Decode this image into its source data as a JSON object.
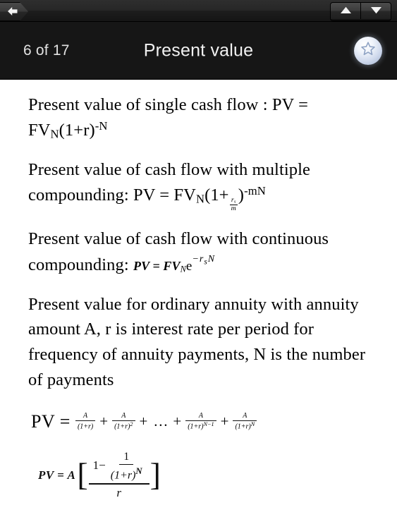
{
  "toolbar": {
    "back_icon": "back-arrow-icon",
    "prev_icon": "triangle-up-icon",
    "next_icon": "triangle-down-icon"
  },
  "header": {
    "page_counter": "6 of 17",
    "title": "Present value",
    "favorite_icon": "star-icon"
  },
  "content": {
    "blocks": [
      {
        "lead": "Present value of single cash flow : PV = FV",
        "sub1": "N",
        "mid": "(1+r)",
        "sup1": "-N"
      },
      {
        "lead": "Present value of cash flow with multiple compounding: PV = FV",
        "sub1": "N",
        "mid": "(1+",
        "frac_num": "r",
        "frac_num_sub": "s",
        "frac_den": "m",
        "close": ")",
        "sup1": "-mN"
      },
      {
        "lead": "Present value of cash flow with continuous compounding:",
        "formula_pv": "PV = FV",
        "formula_sub": "N",
        "formula_e": "e",
        "formula_exp_minus": "−",
        "formula_exp_r": "r",
        "formula_exp_sub": "s",
        "formula_exp_n": "N"
      },
      {
        "text": "Present value for ordinary annuity with annuity amount A, r is interest rate per period for frequency of annuity payments, N is the number of payments"
      }
    ],
    "sum_formula": {
      "lhs": "PV =",
      "terms": [
        {
          "num": "A",
          "den": "(1+r)",
          "den_sup": ""
        },
        {
          "num": "A",
          "den": "(1+r)",
          "den_sup": "2"
        },
        {
          "num": "A",
          "den": "(1+r)",
          "den_sup": "N−1"
        },
        {
          "num": "A",
          "den": "(1+r)",
          "den_sup": "N"
        }
      ],
      "plus": "+",
      "ellipsis": "…"
    },
    "final_formula": {
      "lead": "PV = A",
      "open_bracket": "[",
      "close_bracket": "]",
      "one": "1",
      "minus": "−",
      "inner_num": "1",
      "inner_den": "(1+r)",
      "inner_den_sup": "N",
      "outer_den": "r"
    }
  },
  "colors": {
    "chrome": "#161616",
    "content_bg": "#ffffff",
    "title_text": "#f2f2f2",
    "counter_text": "#e2e2e2",
    "star_fill": "#dfe7f5"
  }
}
